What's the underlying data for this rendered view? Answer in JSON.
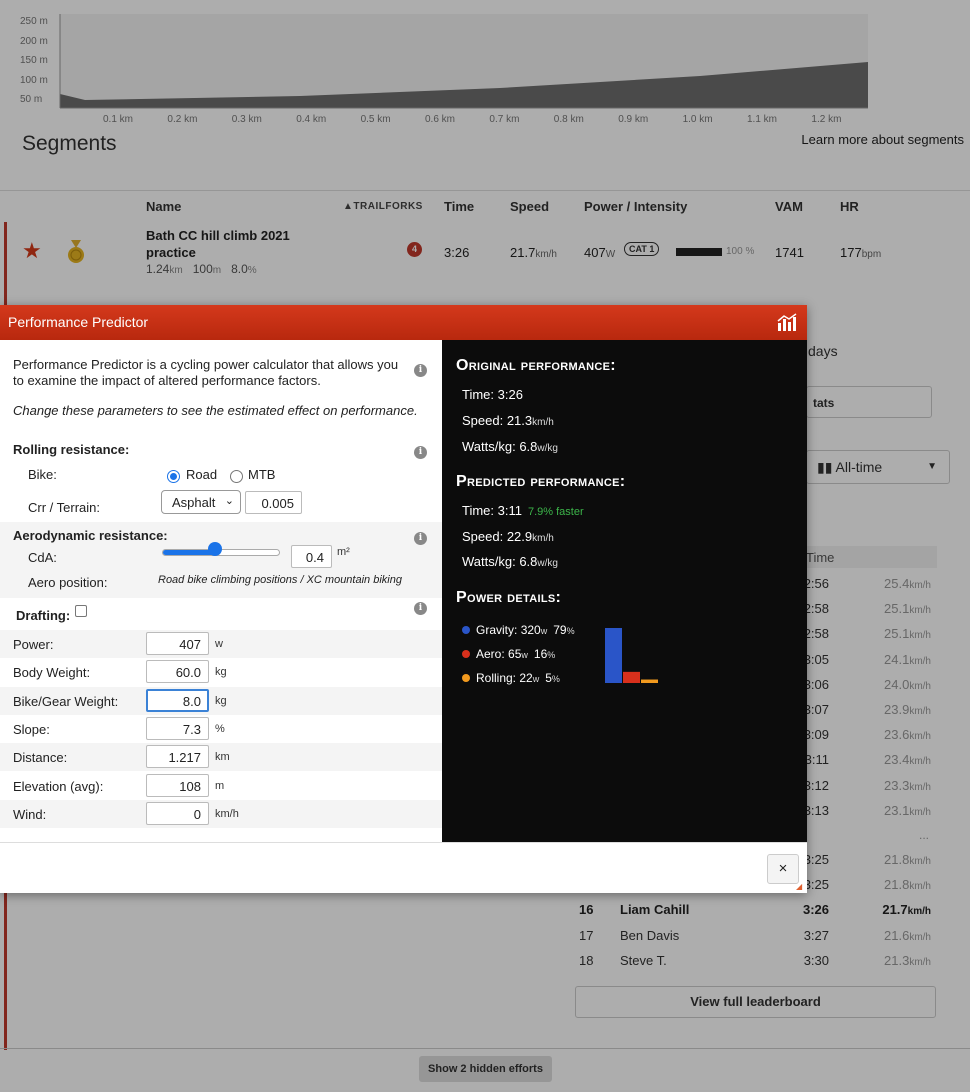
{
  "elevation": {
    "y_ticks": [
      "250 m",
      "200 m",
      "150 m",
      "100 m",
      "50 m"
    ],
    "x_ticks": [
      "0.1 km",
      "0.2 km",
      "0.3 km",
      "0.4 km",
      "0.5 km",
      "0.6 km",
      "0.7 km",
      "0.8 km",
      "0.9 km",
      "1.0 km",
      "1.1 km",
      "1.2 km"
    ]
  },
  "segments": {
    "title": "Segments",
    "learn_more": "Learn more about segments",
    "columns": {
      "name": "Name",
      "trailforks": "TRAILFORKS",
      "time": "Time",
      "speed": "Speed",
      "power": "Power / Intensity",
      "vam": "VAM",
      "hr": "HR"
    },
    "row": {
      "name": "Bath CC hill climb 2021 practice",
      "distance": "1.24",
      "distance_unit": "km",
      "elevation": "100",
      "elevation_unit": "m",
      "grade": "8.0",
      "grade_unit": "%",
      "badge": "4",
      "time": "3:26",
      "speed": "21.7",
      "speed_unit": "km/h",
      "power": "407",
      "power_unit": "W",
      "cat": "CAT 1",
      "intensity": "100 %",
      "intensity_value": 100,
      "vam": "1741",
      "hr": "177",
      "hr_unit": "bpm"
    }
  },
  "side": {
    "days": "days",
    "stats": "tats",
    "filter": "All-time",
    "time_header": "Time"
  },
  "leaderboard": {
    "rows": [
      {
        "rank": "",
        "name": "",
        "time": "2:56",
        "speed": "25.4",
        "unit": "km/h"
      },
      {
        "rank": "",
        "name": "",
        "time": "2:58",
        "speed": "25.1",
        "unit": "km/h"
      },
      {
        "rank": "",
        "name": "",
        "time": "2:58",
        "speed": "25.1",
        "unit": "km/h"
      },
      {
        "rank": "",
        "name": "",
        "time": "3:05",
        "speed": "24.1",
        "unit": "km/h"
      },
      {
        "rank": "",
        "name": "",
        "time": "3:06",
        "speed": "24.0",
        "unit": "km/h"
      },
      {
        "rank": "",
        "name": "",
        "time": "3:07",
        "speed": "23.9",
        "unit": "km/h"
      },
      {
        "rank": "",
        "name": "",
        "time": "3:09",
        "speed": "23.6",
        "unit": "km/h"
      },
      {
        "rank": "",
        "name": "",
        "time": "3:11",
        "speed": "23.4",
        "unit": "km/h"
      },
      {
        "rank": "",
        "name": "",
        "time": "3:12",
        "speed": "23.3",
        "unit": "km/h"
      },
      {
        "rank": "",
        "name": "",
        "time": "3:13",
        "speed": "23.1",
        "unit": "km/h"
      }
    ],
    "ellipsis": "...",
    "rows2": [
      {
        "rank": "",
        "name": "",
        "time": "3:25",
        "speed": "21.8",
        "unit": "km/h"
      },
      {
        "rank": "",
        "name": "",
        "time": "3:25",
        "speed": "21.8",
        "unit": "km/h"
      },
      {
        "rank": "16",
        "name": "Liam Cahill",
        "time": "3:26",
        "speed": "21.7",
        "unit": "km/h"
      },
      {
        "rank": "17",
        "name": "Ben Davis",
        "time": "3:27",
        "speed": "21.6",
        "unit": "km/h"
      },
      {
        "rank": "18",
        "name": "Steve T.",
        "time": "3:30",
        "speed": "21.3",
        "unit": "km/h"
      }
    ],
    "full_button": "View full leaderboard",
    "hidden_button": "Show 2 hidden efforts"
  },
  "modal": {
    "title": "Performance Predictor",
    "intro": "Performance Predictor is a cycling power calculator that allows you to examine the impact of altered performance factors.",
    "intro_italic": "Change these parameters to see the estimated effect on performance.",
    "rolling": {
      "title": "Rolling resistance:",
      "bike_label": "Bike:",
      "road": "Road",
      "mtb": "MTB",
      "crr_label": "Crr / Terrain:",
      "terrain": "Asphalt",
      "crr": "0.005"
    },
    "aero": {
      "title": "Aerodynamic resistance:",
      "cda_label": "CdA:",
      "cda_value": "0.4",
      "cda_unit": "m²",
      "cda_slider": 0.46,
      "position_label": "Aero position:",
      "position_desc": "Road bike climbing positions / XC mountain biking"
    },
    "drafting_label": "Drafting:",
    "params": [
      {
        "label": "Power:",
        "value": "407",
        "unit": "w"
      },
      {
        "label": "Body Weight:",
        "value": "60.0",
        "unit": "kg"
      },
      {
        "label": "Bike/Gear Weight:",
        "value": "8.0",
        "unit": "kg"
      },
      {
        "label": "Slope:",
        "value": "7.3",
        "unit": "%"
      },
      {
        "label": "Distance:",
        "value": "1.217",
        "unit": "km"
      },
      {
        "label": "Elevation (avg):",
        "value": "108",
        "unit": "m"
      },
      {
        "label": "Wind:",
        "value": "0",
        "unit": "km/h"
      }
    ],
    "original": {
      "title": "Original performance:",
      "time_label": "Time:",
      "time": "3:26",
      "speed_label": "Speed:",
      "speed": "21.3",
      "speed_unit": "km/h",
      "wkg_label": "Watts/kg:",
      "wkg": "6.8",
      "wkg_unit": "w/kg"
    },
    "predicted": {
      "title": "Predicted performance:",
      "time_label": "Time:",
      "time": "3:11",
      "faster": "7.9% faster",
      "speed_label": "Speed:",
      "speed": "22.9",
      "speed_unit": "km/h",
      "wkg_label": "Watts/kg:",
      "wkg": "6.8",
      "wkg_unit": "w/kg"
    },
    "power": {
      "title": "Power details:",
      "items": [
        {
          "label": "Gravity:",
          "value": "320",
          "unit": "w",
          "pct": "79",
          "color": "#2a55c8",
          "fraction": 0.79
        },
        {
          "label": "Aero:",
          "value": "65",
          "unit": "w",
          "pct": "16",
          "color": "#d8301c",
          "fraction": 0.16
        },
        {
          "label": "Rolling:",
          "value": "22",
          "unit": "w",
          "pct": "5",
          "color": "#f29a1e",
          "fraction": 0.05
        }
      ],
      "pct_unit": "%"
    },
    "close": "×"
  }
}
